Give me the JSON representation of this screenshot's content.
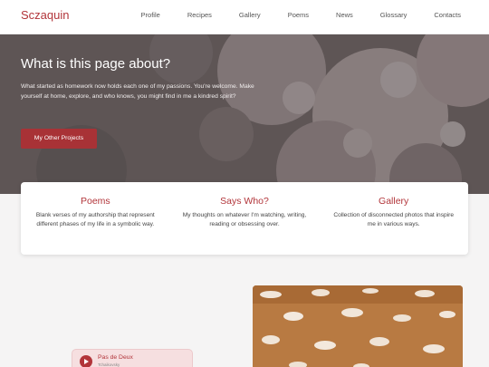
{
  "nav": {
    "brand": "Sczaquin",
    "links": [
      "Profile",
      "Recipes",
      "Gallery",
      "Poems",
      "News",
      "Glossary",
      "Contacts"
    ]
  },
  "hero": {
    "title": "What is this page about?",
    "text": "What started as homework now holds each one of my passions. You're welcome. Make yourself at home, explore, and who knows, you might find in me a kindred spirit?",
    "button": "My Other Projects"
  },
  "cards": [
    {
      "title": "Poems",
      "text": "Blank verses of my authorship that represent different phases of my life in a symbolic way."
    },
    {
      "title": "Says Who?",
      "text": "My thoughts on whatever I'm watching, writing, reading or obsessing over."
    },
    {
      "title": "Gallery",
      "text": "Collection of disconnected photos that inspire me in various ways."
    }
  ],
  "player": {
    "track": "Pas de Deux",
    "artist": "Tchaikovsky"
  },
  "colors": {
    "accent": "#b2353a",
    "button": "#a83236",
    "background": "#f5f4f4"
  },
  "icons": {
    "play": "play-icon"
  }
}
